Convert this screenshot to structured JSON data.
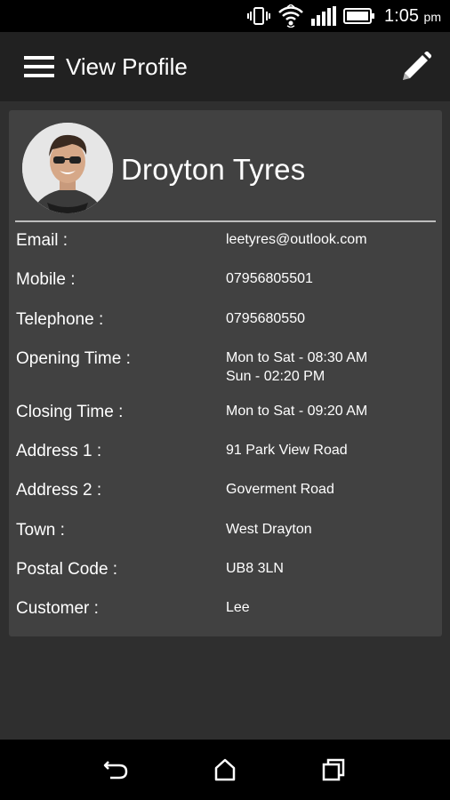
{
  "status_bar": {
    "time": "1:05",
    "time_suffix": "pm",
    "icons": [
      "vibrate-icon",
      "wifi-icon",
      "signal-icon",
      "battery-icon"
    ]
  },
  "app_bar": {
    "title": "View Profile",
    "menu_icon": "hamburger-menu-icon",
    "edit_icon": "pencil-edit-icon"
  },
  "profile": {
    "name": "Droyton Tyres",
    "fields": [
      {
        "label": "Email :",
        "value": "leetyres@outlook.com"
      },
      {
        "label": "Mobile :",
        "value": "07956805501"
      },
      {
        "label": "Telephone :",
        "value": "0795680550"
      },
      {
        "label": "Opening Time :",
        "value": "Mon to Sat - 08:30 AM",
        "value2": "Sun - 02:20 PM"
      },
      {
        "label": "Closing Time :",
        "value": "Mon to Sat - 09:20 AM"
      },
      {
        "label": "Address 1 :",
        "value": "91 Park View Road"
      },
      {
        "label": "Address 2 :",
        "value": "Goverment Road"
      },
      {
        "label": "Town :",
        "value": "West Drayton"
      },
      {
        "label": "Postal Code  :",
        "value": "UB8 3LN"
      },
      {
        "label": "Customer  :",
        "value": "Lee"
      }
    ]
  },
  "nav_bar": {
    "icons": [
      "back-icon",
      "home-icon",
      "recents-icon"
    ]
  },
  "colors": {
    "background": "#2f2f2f",
    "app_bar": "#212121",
    "card": "#414141",
    "divider": "#bdbdbd"
  }
}
